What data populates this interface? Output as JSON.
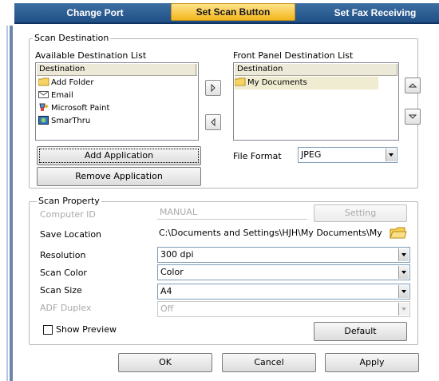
{
  "tabs": [
    "Change Port",
    "Set Scan Button",
    "Set Fax Receiving"
  ],
  "active_tab": 1,
  "scan_destination": {
    "group_label": "Scan Destination",
    "available_label": "Available Destination List",
    "available_header": "Destination",
    "available_items": [
      {
        "label": "Add Folder",
        "icon": "folder-icon"
      },
      {
        "label": "Email",
        "icon": "email-icon"
      },
      {
        "label": "Microsoft Paint",
        "icon": "paint-icon"
      },
      {
        "label": "SmarThru",
        "icon": "smarthru-icon"
      }
    ],
    "front_panel_label": "Front Panel Destination List",
    "front_panel_header": "Destination",
    "front_panel_items": [
      {
        "label": "My Documents",
        "icon": "folder-icon"
      }
    ],
    "add_button": "Add Application",
    "remove_button": "Remove Application",
    "file_format_label": "File Format",
    "file_format_value": "JPEG"
  },
  "scan_property": {
    "group_label": "Scan Property",
    "computer_id_label": "Computer ID",
    "computer_id_value": "MANUAL",
    "setting_button": "Setting",
    "save_location_label": "Save Location",
    "save_location_value": "C:\\Documents and Settings\\HJH\\My Documents\\My Pic",
    "resolution_label": "Resolution",
    "resolution_value": "300 dpi",
    "scan_color_label": "Scan Color",
    "scan_color_value": "Color",
    "scan_size_label": "Scan Size",
    "scan_size_value": "A4",
    "adf_duplex_label": "ADF Duplex",
    "adf_duplex_value": "Off",
    "show_preview_label": "Show Preview",
    "default_button": "Default"
  },
  "footer": {
    "ok": "OK",
    "cancel": "Cancel",
    "apply": "Apply"
  },
  "colors": {
    "tab_bar": "#2a5a8e",
    "active_tab": "#f3b61c",
    "selected_item": "#f0ecd2"
  }
}
